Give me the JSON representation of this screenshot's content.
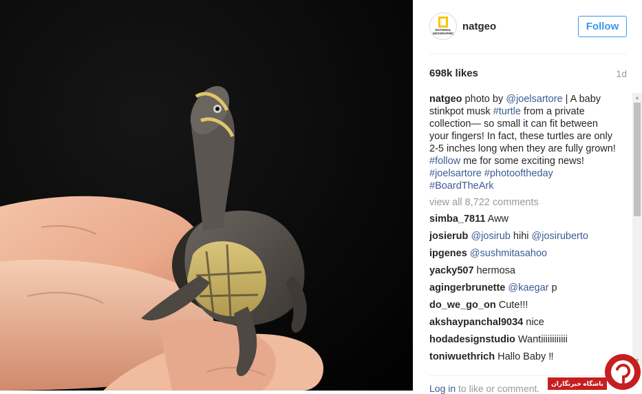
{
  "post": {
    "username": "natgeo",
    "avatar_logo_text": "NATIONAL GEOGRAPHIC",
    "follow_label": "Follow",
    "likes": "698k likes",
    "age": "1d"
  },
  "caption": {
    "user": "natgeo",
    "t1": " photo by ",
    "tag_user": "@joelsartore",
    "t2": " | A baby stinkpot musk ",
    "tag_turtle": "#turtle",
    "t3": " from a private collection— so small it can fit between your fingers! In fact, these turtles are only 2-5 inches long when they are fully grown! ",
    "tag_follow": "#follow",
    "t4": " me for some exciting news! ",
    "tag_joel": "#joelsartore",
    "tag_photo": "#photooftheday",
    "tag_ark": "#BoardTheArk"
  },
  "view_all": "view all 8,722 comments",
  "comments": [
    {
      "user": "simba_7811",
      "parts": [
        {
          "text": "Aww",
          "tag": false
        }
      ]
    },
    {
      "user": "josierub",
      "parts": [
        {
          "text": "@josirub",
          "tag": true
        },
        {
          "text": " hihi ",
          "tag": false
        },
        {
          "text": "@josiruberto",
          "tag": true
        }
      ]
    },
    {
      "user": "ipgenes",
      "parts": [
        {
          "text": "@sushmitasahoo",
          "tag": true
        }
      ]
    },
    {
      "user": "yacky507",
      "parts": [
        {
          "text": "hermosa",
          "tag": false
        }
      ]
    },
    {
      "user": "agingerbrunette",
      "parts": [
        {
          "text": "@kaegar",
          "tag": true
        },
        {
          "text": " p",
          "tag": false
        }
      ]
    },
    {
      "user": "do_we_go_on",
      "parts": [
        {
          "text": "Cute!!!",
          "tag": false
        }
      ]
    },
    {
      "user": "akshaypanchal9034",
      "parts": [
        {
          "text": "nice",
          "tag": false
        }
      ]
    },
    {
      "user": "hodadesignstudio",
      "parts": [
        {
          "text": "Wantiiiiiiiiiiii",
          "tag": false
        }
      ]
    },
    {
      "user": "toniwuethrich",
      "parts": [
        {
          "text": "Hallo Baby ‼",
          "tag": false
        }
      ]
    }
  ],
  "footer": {
    "login_link": "Log in",
    "login_rest": " to like or comment."
  },
  "watermark": {
    "text": "باشگاه خبرنگاران"
  },
  "colors": {
    "link": "#3b5c94",
    "follow_blue": "#3897f0",
    "muted": "#999999",
    "watermark_red": "#c61f1f"
  }
}
